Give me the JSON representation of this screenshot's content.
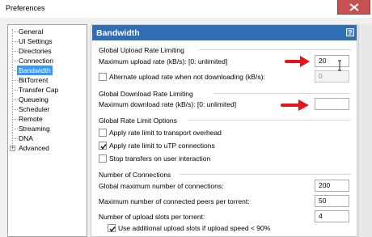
{
  "window": {
    "title": "Preferences"
  },
  "sidebar": {
    "items": [
      {
        "label": "General",
        "selected": false
      },
      {
        "label": "UI Settings",
        "selected": false
      },
      {
        "label": "Directories",
        "selected": false
      },
      {
        "label": "Connection",
        "selected": false
      },
      {
        "label": "Bandwidth",
        "selected": true
      },
      {
        "label": "BitTorrent",
        "selected": false
      },
      {
        "label": "Transfer Cap",
        "selected": false
      },
      {
        "label": "Queueing",
        "selected": false
      },
      {
        "label": "Scheduler",
        "selected": false
      },
      {
        "label": "Remote",
        "selected": false
      },
      {
        "label": "Streaming",
        "selected": false
      },
      {
        "label": "DNA",
        "selected": false
      },
      {
        "label": "Advanced",
        "selected": false,
        "expander": "+"
      }
    ]
  },
  "panel": {
    "title": "Bandwidth",
    "help_label": "?",
    "upload": {
      "group_title": "Global Upload Rate Limiting",
      "max_label": "Maximum upload rate (kB/s): [0: unlimited]",
      "max_value": "20",
      "alt_label": "Alternate upload rate when not downloading (kB/s):",
      "alt_checked": false,
      "alt_value": "0"
    },
    "download": {
      "group_title": "Global Download Rate Limiting",
      "max_label": "Maximum download rate (kB/s): [0: unlimited]",
      "max_value": ""
    },
    "options": {
      "group_title": "Global Rate Limit Options",
      "overhead_label": "Apply rate limit to transport overhead",
      "overhead_checked": false,
      "utp_label": "Apply rate limit to uTP connections",
      "utp_checked": true,
      "stop_label": "Stop transfers on user interaction",
      "stop_checked": false
    },
    "connections": {
      "group_title": "Number of Connections",
      "global_label": "Global maximum number of connections:",
      "global_value": "200",
      "peers_label": "Maximum number of connected peers per torrent:",
      "peers_value": "50",
      "slots_label": "Number of upload slots per torrent:",
      "slots_value": "4",
      "extra_label": "Use additional upload slots if upload speed < 90%",
      "extra_checked": true
    }
  },
  "annotation": {
    "arrow_color": "#e8141c"
  }
}
